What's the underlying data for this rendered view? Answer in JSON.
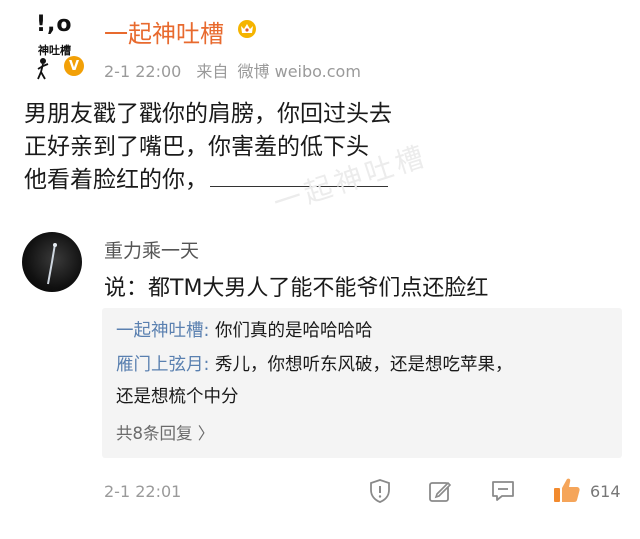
{
  "post": {
    "author": "一起神吐槽",
    "logo_top": "!,o",
    "logo_text": "神吐槽",
    "verified_symbol": "V",
    "time": "2-1 22:00",
    "source_prefix": "来自",
    "source": "微博 weibo.com",
    "lines": [
      "男朋友戳了戳你的肩膀，你回过头去",
      "正好亲到了嘴巴，你害羞的低下头",
      "他看着脸红的你，"
    ],
    "watermark": "一起神吐槽"
  },
  "comment": {
    "author": "重力乘一天",
    "text": "说：都TM大男人了能不能爷们点还脸红",
    "replies": [
      {
        "user": "一起神吐槽:",
        "text": " 你们真的是哈哈哈哈"
      },
      {
        "user": "雁门上弦月:",
        "text": " 秀儿，你想听东风破，还是想吃苹果，",
        "cont": "还是想梳个中分"
      }
    ],
    "more_replies": "共8条回复 〉",
    "time": "2-1 22:01",
    "likes": "614"
  },
  "icons": [
    "crown-icon",
    "report-icon",
    "edit-icon",
    "comment-icon",
    "like-icon"
  ],
  "colors": {
    "author": "#e86a2e",
    "reply_user": "#5a80b0",
    "like": "#f28a2e"
  }
}
